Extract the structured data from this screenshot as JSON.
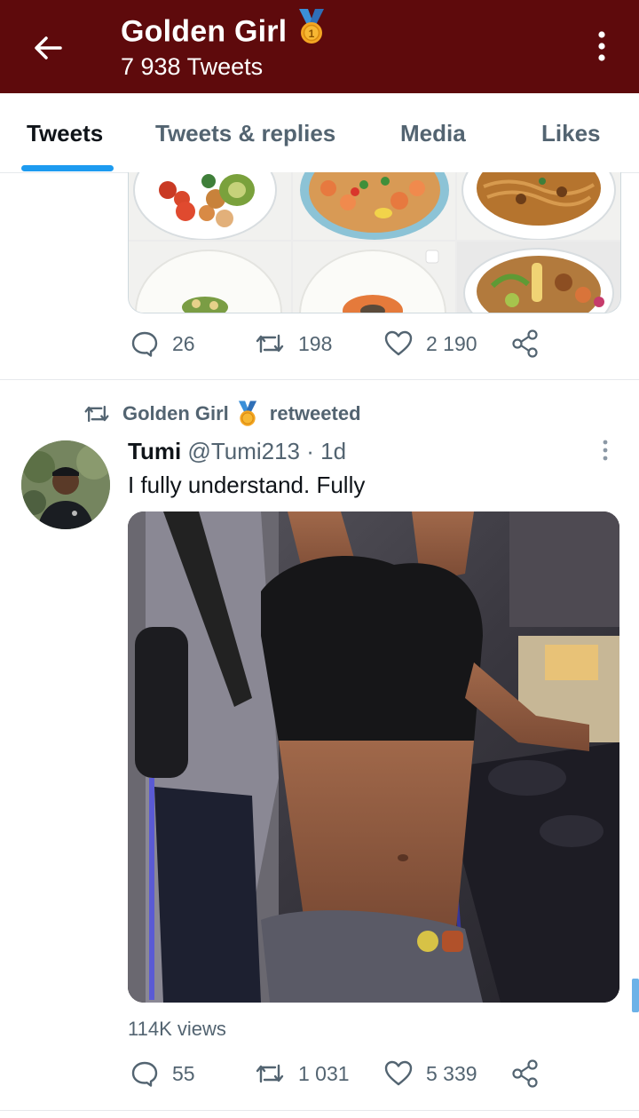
{
  "header": {
    "title": "Golden Girl",
    "subtitle": "7 938 Tweets",
    "bg_color": "#5e0a0c",
    "back_icon": "arrow-left-icon",
    "more_icon": "more-vertical-icon",
    "badge_icon": "medal-icon"
  },
  "tabs": [
    {
      "label": "Tweets",
      "active": true
    },
    {
      "label": "Tweets & replies",
      "active": false
    },
    {
      "label": "Media",
      "active": false
    },
    {
      "label": "Likes",
      "active": false
    }
  ],
  "tweet1": {
    "replies": "26",
    "retweets": "198",
    "likes": "2 190"
  },
  "tweet2": {
    "retweeted_by": "Golden Girl",
    "retweeted_label": "retweeted",
    "name": "Tumi",
    "handle": "@Tumi213",
    "time": "· 1d",
    "text": "I fully understand. Fully",
    "views": "114K views",
    "replies": "55",
    "retweets": "1 031",
    "likes": "5 339"
  },
  "colors": {
    "accent": "#1d9bf0",
    "muted": "#536471",
    "text": "#0f1419"
  }
}
